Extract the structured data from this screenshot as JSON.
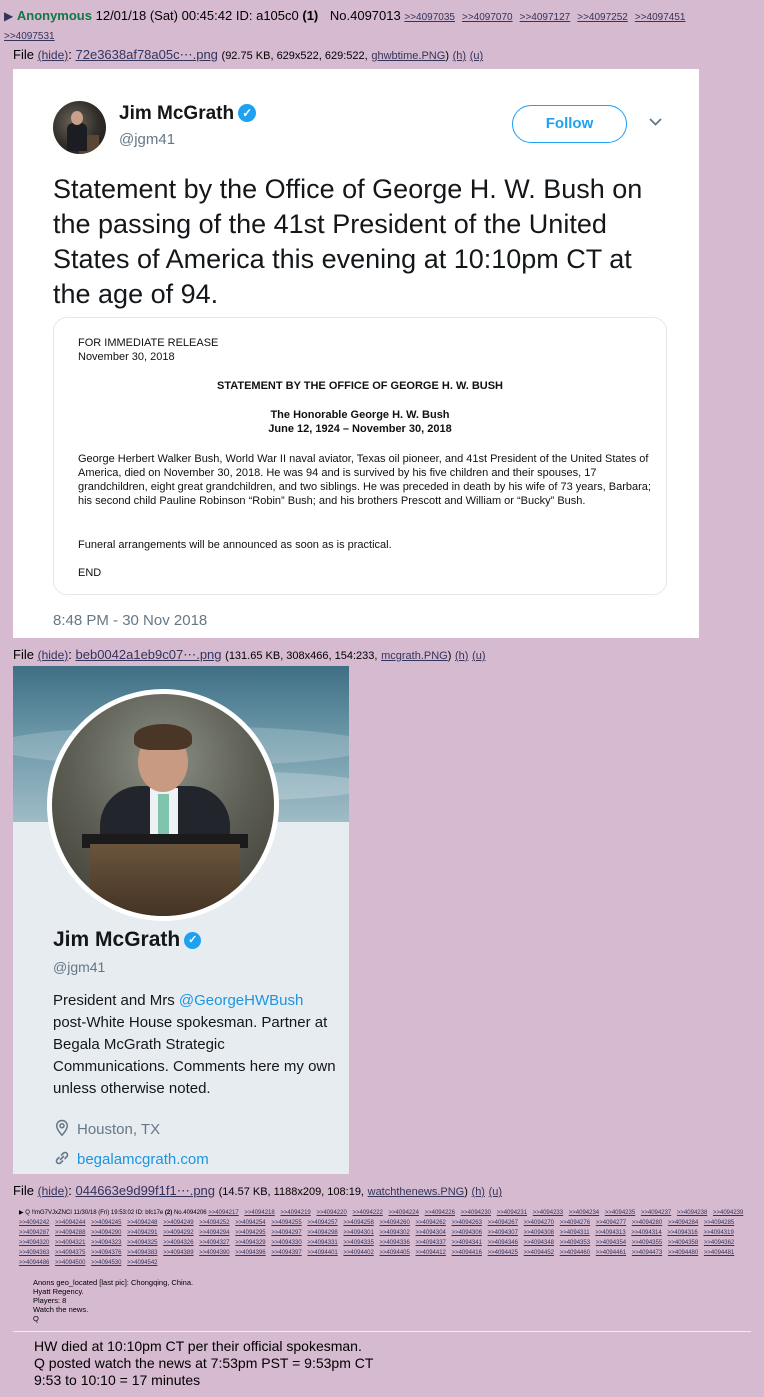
{
  "post": {
    "name": "Anonymous",
    "datetime": "12/01/18 (Sat) 00:45:42",
    "id_label": "ID:",
    "id": "a105c0",
    "id_count": "(1)",
    "number": "No.4097013",
    "backlinks": [
      ">>4097035",
      ">>4097070",
      ">>4097127",
      ">>4097252",
      ">>4097451",
      ">>4097531"
    ]
  },
  "files": [
    {
      "label": "File",
      "hide": "(hide)",
      "name": "72e3638af78a05c⋯.png",
      "meta": "(92.75 KB, 629x522, 629:522,",
      "orig": "ghwbtime.PNG",
      "h": "(h)",
      "u": "(u)"
    },
    {
      "label": "File",
      "hide": "(hide)",
      "name": "beb0042a1eb9c07⋯.png",
      "meta": "(131.65 KB, 308x466, 154:233,",
      "orig": "mcgrath.PNG",
      "h": "(h)",
      "u": "(u)"
    },
    {
      "label": "File",
      "hide": "(hide)",
      "name": "044663e9d99f1f1⋯.png",
      "meta": "(14.57 KB, 1188x209, 108:19,",
      "orig": "watchthenews.PNG",
      "h": "(h)",
      "u": "(u)"
    }
  ],
  "tweet": {
    "name": "Jim McGrath",
    "handle": "@jgm41",
    "follow_label": "Follow",
    "text": "Statement by the Office of George H. W. Bush on the passing of the 41st President of the United States of America this evening at 10:10pm CT at the age of 94.",
    "time": "8:48 PM - 30 Nov 2018",
    "doc": {
      "release_line1": "FOR IMMEDIATE RELEASE",
      "release_line2": "November 30, 2018",
      "title": "STATEMENT BY THE OFFICE OF GEORGE H. W. BUSH",
      "honorable": "The Honorable George H. W. Bush",
      "dates": "June 12, 1924 – November 30, 2018",
      "body": "George Herbert Walker Bush, World War II naval aviator, Texas oil pioneer, and 41st President of the United States of America, died on November 30, 2018.  He was 94 and is survived by his five children and their spouses, 17 grandchildren, eight great grandchildren, and two siblings.  He was preceded in death by his wife of 73 years, Barbara; his second child Pauline Robinson “Robin” Bush; and his brothers Prescott and William or “Bucky” Bush.",
      "funeral": "Funeral arrangements will be announced as soon as is practical.",
      "end": "END"
    }
  },
  "profile": {
    "name": "Jim McGrath",
    "handle": "@jgm41",
    "bio_prefix": "President and Mrs ",
    "bio_mention": "@GeorgeHWBush",
    "bio_rest": " post-White House spokesman. Partner at Begala McGrath Strategic Communications. Comments here my own unless otherwise noted.",
    "location": "Houston, TX",
    "url": "begalamcgrath.com"
  },
  "third_image": {
    "trip": "!!mG7VJxZNCI",
    "datetime": "11/30/18 (Fri) 19:53:02 ID: bfc17e",
    "count": "(2)",
    "number": "No.4094206",
    "links": [
      ">>4094217",
      ">>4094218",
      ">>4094219",
      ">>4094220",
      ">>4094222",
      ">>4094224",
      ">>4094226",
      ">>4094230",
      ">>4094231",
      ">>4094233",
      ">>4094234",
      ">>4094235",
      ">>4094237",
      ">>4094238",
      ">>4094239",
      ">>4094242",
      ">>4094244",
      ">>4094245",
      ">>4094248",
      ">>4094249",
      ">>4094252",
      ">>4094254",
      ">>4094255",
      ">>4094257",
      ">>4094258",
      ">>4094260",
      ">>4094262",
      ">>4094263",
      ">>4094267",
      ">>4094270",
      ">>4094276",
      ">>4094277",
      ">>4094280",
      ">>4094284",
      ">>4094285",
      ">>4094287",
      ">>4094288",
      ">>4094290",
      ">>4094291",
      ">>4094292",
      ">>4094294",
      ">>4094295",
      ">>4094297",
      ">>4094298",
      ">>4094301",
      ">>4094302",
      ">>4094304",
      ">>4094306",
      ">>4094307",
      ">>4094308",
      ">>4094311",
      ">>4094313",
      ">>4094314",
      ">>4094316",
      ">>4094319",
      ">>4094320",
      ">>4094321",
      ">>4094323",
      ">>4094325",
      ">>4094326",
      ">>4094327",
      ">>4094329",
      ">>4094330",
      ">>4094331",
      ">>4094335",
      ">>4094336",
      ">>4094337",
      ">>4094341",
      ">>4094346",
      ">>4094348",
      ">>4094353",
      ">>4094354",
      ">>4094355",
      ">>4094358",
      ">>4094362",
      ">>4094363",
      ">>4094375",
      ">>4094376",
      ">>4094383",
      ">>4094389",
      ">>4094390",
      ">>4094396",
      ">>4094397",
      ">>4094401",
      ">>4094402",
      ">>4094405",
      ">>4094412",
      ">>4094416",
      ">>4094425",
      ">>4094452",
      ">>4094460",
      ">>4094461",
      ">>4094473",
      ">>4094480",
      ">>4094481",
      ">>4094486",
      ">>4094500",
      ">>4094530",
      ">>4094542"
    ],
    "message": [
      "Anons geo_located [last pic]: Chongqing, China.",
      "Hyatt Regency.",
      "Players: 8",
      "Watch the news.",
      "Q"
    ]
  },
  "comment": [
    "HW died at 10:10pm CT per their official spokesman.",
    "Q posted watch the news at 7:53pm PST = 9:53pm CT",
    "9:53 to 10:10 = 17 minutes"
  ]
}
